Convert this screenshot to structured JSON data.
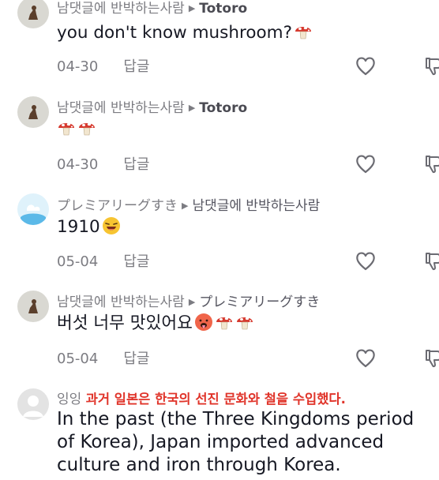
{
  "comments": [
    {
      "author": "남댓글에 반박하는사람",
      "reply_to": "Totoro",
      "text": "you don't know mushroom?",
      "date": "04-30",
      "reply_label": "답글",
      "avatar_icon": "owl-avatar-icon"
    },
    {
      "author": "남댓글에 반박하는사람",
      "reply_to": "Totoro",
      "text": "",
      "date": "04-30",
      "reply_label": "답글",
      "avatar_icon": "owl-avatar-icon"
    },
    {
      "author": "プレミアリーグすき",
      "reply_to": "남댓글에 반박하는사람",
      "text": "1910",
      "date": "05-04",
      "reply_label": "답글",
      "avatar_icon": "cloud-avatar-icon"
    },
    {
      "author": "남댓글에 반박하는사람",
      "reply_to": "プレミアリーグすき",
      "text": "버섯 너무 맛있어요",
      "date": "05-04",
      "reply_label": "답글",
      "avatar_icon": "owl-avatar-icon"
    }
  ],
  "last_comment": {
    "author": "잉잉",
    "korean_text": "과거 일본은 한국의 선진 문화와 철을 수입했다.",
    "english_lines": [
      "In the past (the Three Kingdoms period",
      "of Korea), Japan imported advanced",
      "culture and iron through Korea."
    ],
    "avatar_icon": "default-avatar-icon"
  },
  "colors": {
    "accent_red": "#e0342a",
    "meta_gray": "#7c7c82",
    "text_dark": "#161823"
  }
}
